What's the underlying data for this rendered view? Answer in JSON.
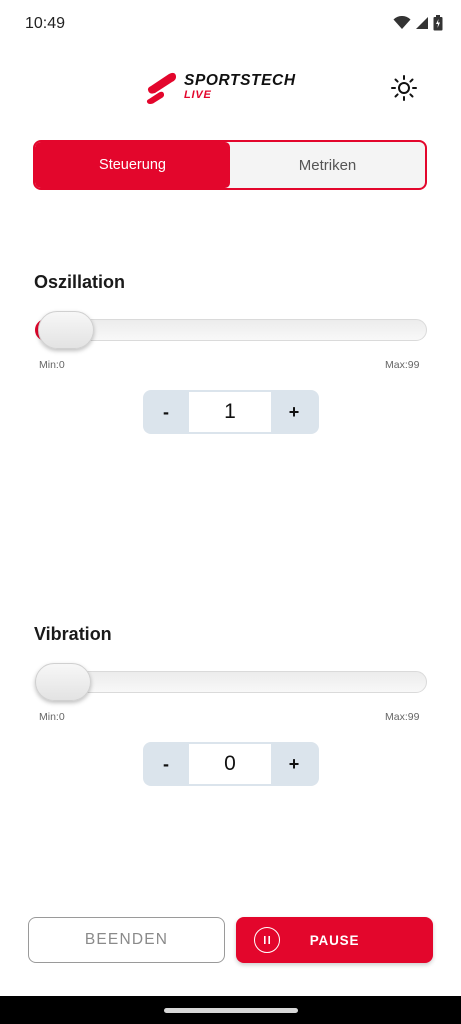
{
  "status_bar": {
    "time": "10:49",
    "icons": [
      "wifi-icon",
      "cell-signal-icon",
      "battery-icon"
    ]
  },
  "header": {
    "brand_title": "SPORTSTECH",
    "brand_subtitle": "LIVE",
    "theme_icon": "sun-icon"
  },
  "tabs": [
    {
      "label": "Steuerung",
      "active": true
    },
    {
      "label": "Metriken",
      "active": false
    }
  ],
  "oscillation": {
    "title": "Oszillation",
    "min_label": "Min:0",
    "max_label": "Max:99",
    "value": 1,
    "value_text": "1",
    "minus": "-",
    "plus": "+"
  },
  "vibration": {
    "title": "Vibration",
    "min_label": "Min:0",
    "max_label": "Max:99",
    "value": 0,
    "value_text": "0",
    "minus": "-",
    "plus": "+"
  },
  "actions": {
    "end_label": "BEENDEN",
    "pause_label": "PAUSE",
    "pause_icon": "pause-icon"
  },
  "colors": {
    "accent": "#e3062c",
    "stepper_bg": "#dbe4ec"
  }
}
